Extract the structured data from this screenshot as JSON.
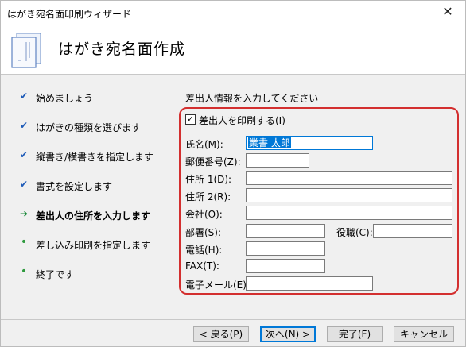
{
  "window": {
    "title": "はがき宛名面印刷ウィザード",
    "close_symbol": "✕"
  },
  "header": {
    "heading": "はがき宛名面作成"
  },
  "steps": [
    {
      "label": "始めましょう",
      "state": "done"
    },
    {
      "label": "はがきの種類を選びます",
      "state": "done"
    },
    {
      "label": "縦書き/横書きを指定します",
      "state": "done"
    },
    {
      "label": "書式を設定します",
      "state": "done"
    },
    {
      "label": "差出人の住所を入力します",
      "state": "current"
    },
    {
      "label": "差し込み印刷を指定します",
      "state": "todo"
    },
    {
      "label": "終了です",
      "state": "todo"
    }
  ],
  "step_icons": {
    "done": "✔",
    "current": "➔",
    "todo": "•"
  },
  "form": {
    "instruction": "差出人情報を入力してください",
    "print_sender_label": "差出人を印刷する(I)",
    "print_sender_checked": true,
    "check_glyph": "✓",
    "fields": {
      "name": {
        "label": "氏名(M):",
        "value": "業書 太郎"
      },
      "postal": {
        "label": "郵便番号(Z):",
        "value": ""
      },
      "address1": {
        "label": "住所 1(D):",
        "value": ""
      },
      "address2": {
        "label": "住所 2(R):",
        "value": ""
      },
      "company": {
        "label": "会社(O):",
        "value": ""
      },
      "department": {
        "label": "部署(S):",
        "value": ""
      },
      "title": {
        "label": "役職(C):",
        "value": ""
      },
      "phone": {
        "label": "電話(H):",
        "value": ""
      },
      "fax": {
        "label": "FAX(T):",
        "value": ""
      },
      "email": {
        "label": "電子メール(E)",
        "value": ""
      }
    }
  },
  "buttons": {
    "back": "< 戻る(P)",
    "next": "次へ(N) >",
    "finish": "完了(F)",
    "cancel": "キャンセル"
  },
  "colors": {
    "highlight_border": "#d32f2f",
    "selection": "#0078d7"
  }
}
